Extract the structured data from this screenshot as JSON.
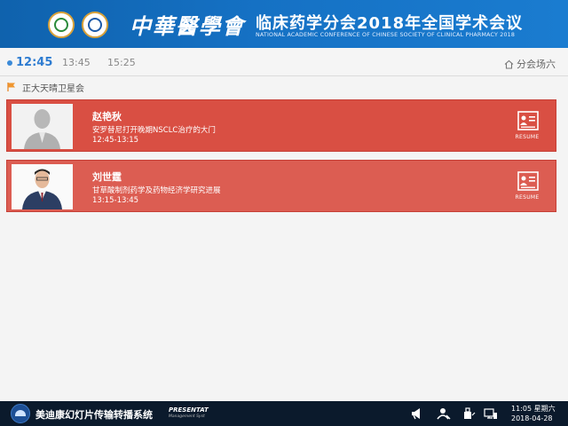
{
  "header": {
    "calligraphy": "中華醫學會",
    "title": "临床药学分会2018年全国学术会议",
    "subtitle": "NATIONAL ACADEMIC CONFERENCE OF CHINESE SOCIETY OF CLINICAL PHARMACY 2018"
  },
  "timebar": {
    "active": "12:45",
    "slots": [
      "13:45",
      "15:25"
    ],
    "venue": "分会场六"
  },
  "section": {
    "label": "正大天晴卫星会"
  },
  "speakers": [
    {
      "name": "赵艳秋",
      "topic": "安罗替尼打开晚期NSCLC治疗的大门",
      "time": "12:45-13:15",
      "resume": "RESUME"
    },
    {
      "name": "刘世霆",
      "topic": "甘草酸制剂药学及药物经济学研究进展",
      "time": "13:15-13:45",
      "resume": "RESUME"
    }
  ],
  "footer": {
    "title": "美迪康幻灯片传输转播系统",
    "brand": "PRESENTAT",
    "brand_sub": "Management Syst",
    "time": "11:05 星期六",
    "date": "2018-04-28"
  },
  "colors": {
    "accent": "#2e7cd1",
    "card_red": "#d94f43",
    "banner_blue": "#1571c4"
  }
}
